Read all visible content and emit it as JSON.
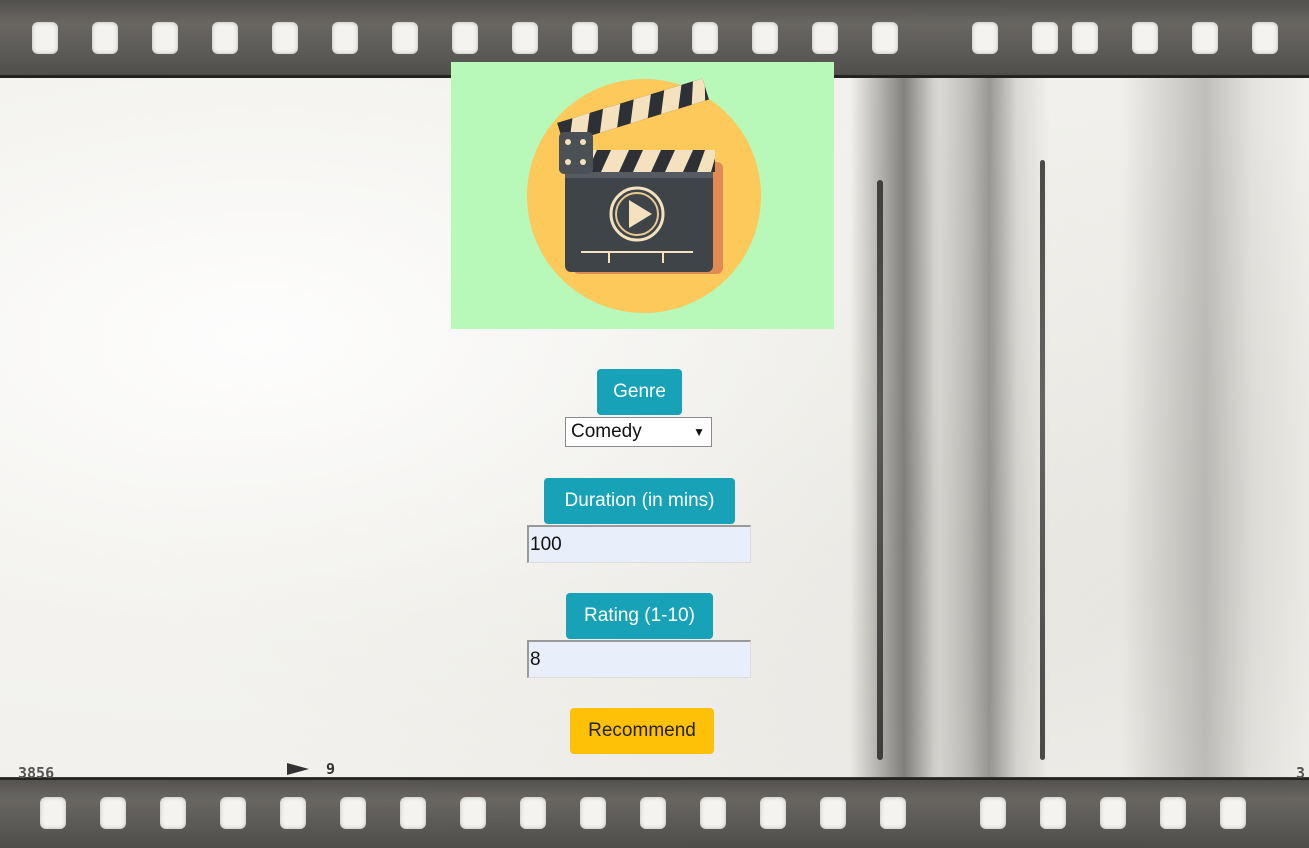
{
  "logo": {
    "icon": "clapperboard-play-icon",
    "background_color": "#b8f8b8",
    "circle_color": "#fdc95a"
  },
  "form": {
    "genre": {
      "label": "Genre",
      "selected": "Comedy"
    },
    "duration": {
      "label": "Duration (in mins)",
      "value": "100"
    },
    "rating": {
      "label": "Rating (1-10)",
      "value": "8"
    },
    "submit_label": "Recommend"
  },
  "background": {
    "edge_codes": [
      "3856",
      "9",
      "3"
    ]
  },
  "colors": {
    "label_button": "#17a2b8",
    "submit_button": "#ffc107",
    "input_fill": "#e8effb"
  }
}
